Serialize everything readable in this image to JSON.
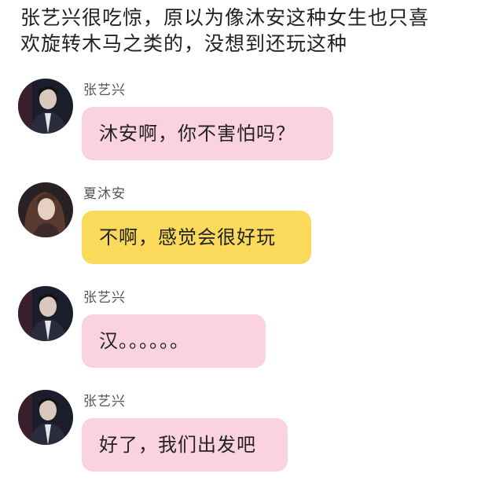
{
  "narration": {
    "line1": "张艺兴很吃惊，原以为像沐安这种女生也只喜",
    "line2": "欢旋转木马之类的，没想到还玩这种"
  },
  "colors": {
    "pink_bubble": "#fbd3df",
    "yellow_bubble": "#fbd95a"
  },
  "messages": [
    {
      "sender": "张艺兴",
      "text": "沐安啊，你不害怕吗？",
      "bubble_color": "pink",
      "avatar_icon": "male-avatar-icon"
    },
    {
      "sender": "夏沐安",
      "text": "不啊，感觉会很好玩",
      "bubble_color": "yellow",
      "avatar_icon": "female-avatar-icon"
    },
    {
      "sender": "张艺兴",
      "text": "汉。。。。。。",
      "bubble_color": "pink",
      "avatar_icon": "male-avatar-icon"
    },
    {
      "sender": "张艺兴",
      "text": "好了，我们出发吧",
      "bubble_color": "pink",
      "avatar_icon": "male-avatar-icon"
    }
  ]
}
